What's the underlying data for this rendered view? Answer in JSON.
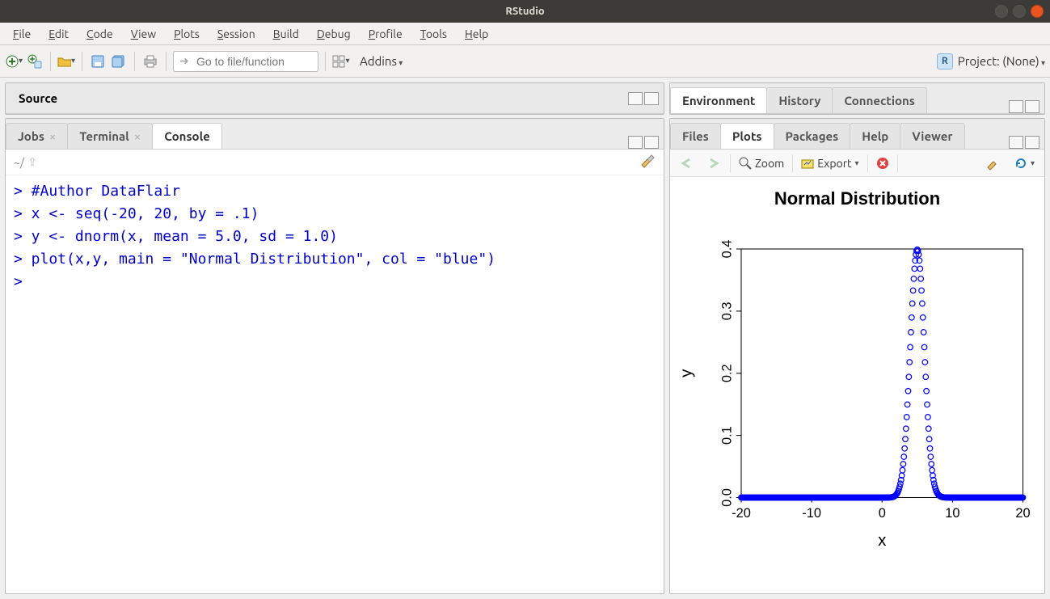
{
  "window": {
    "title": "RStudio"
  },
  "menubar": [
    "File",
    "Edit",
    "Code",
    "View",
    "Plots",
    "Session",
    "Build",
    "Debug",
    "Profile",
    "Tools",
    "Help"
  ],
  "toolbar": {
    "goto_placeholder": "Go to file/function",
    "addins_label": "Addins",
    "project_label": "Project: (None)"
  },
  "left": {
    "source_label": "Source",
    "tabs": [
      {
        "label": "Console",
        "closable": false,
        "active": true
      },
      {
        "label": "Terminal",
        "closable": true,
        "active": false
      },
      {
        "label": "Jobs",
        "closable": true,
        "active": false
      }
    ],
    "wd_label": "~/",
    "console_lines": [
      "> #Author DataFlair",
      "> x <- seq(-20, 20, by = .1)",
      "> y <- dnorm(x, mean = 5.0, sd = 1.0)",
      "> plot(x,y, main = \"Normal Distribution\", col = \"blue\")",
      "> "
    ]
  },
  "right_top": {
    "tabs": [
      "Environment",
      "History",
      "Connections"
    ]
  },
  "right_bottom": {
    "tabs": [
      "Files",
      "Plots",
      "Packages",
      "Help",
      "Viewer"
    ],
    "active_tab": "Plots",
    "zoom_label": "Zoom",
    "export_label": "Export"
  },
  "chart_data": {
    "type": "scatter",
    "title": "Normal Distribution",
    "xlabel": "x",
    "ylabel": "y",
    "xlim": [
      -20,
      20
    ],
    "ylim": [
      0.0,
      0.4
    ],
    "xticks": [
      -20,
      -10,
      0,
      10,
      20
    ],
    "yticks": [
      0.0,
      0.1,
      0.2,
      0.3,
      0.4
    ],
    "color": "#0000ff",
    "series_description": "y = dnorm(x, mean=5.0, sd=1.0) sampled x=-20..20 step 0.1",
    "mean": 5.0,
    "sd": 1.0,
    "x_step": 0.1
  }
}
